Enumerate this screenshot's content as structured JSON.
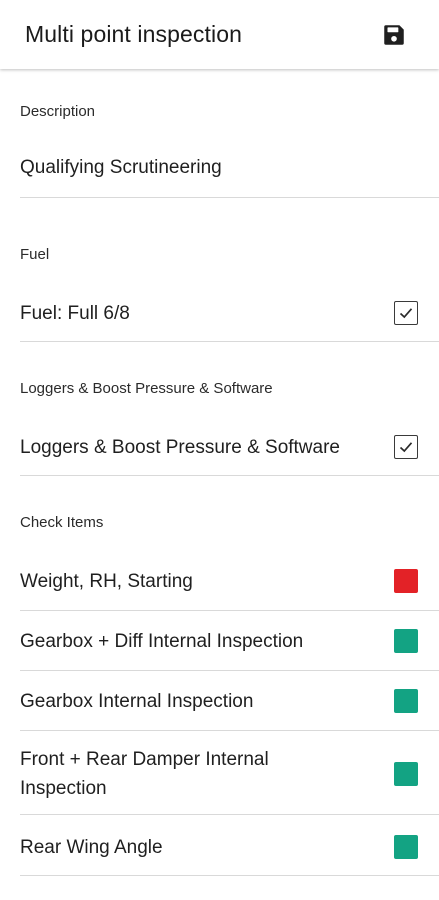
{
  "header": {
    "title": "Multi point inspection",
    "save_icon": "save-icon"
  },
  "description": {
    "label": "Description",
    "value": "Qualifying Scrutineering"
  },
  "fuel": {
    "section_label": "Fuel",
    "item_label": "Fuel: Full 6/8",
    "checked": true
  },
  "loggers": {
    "section_label": "Loggers & Boost Pressure & Software",
    "item_label": "Loggers & Boost Pressure & Software",
    "checked": true
  },
  "check_items": {
    "section_label": "Check Items",
    "items": [
      {
        "label": "Weight, RH, Starting",
        "status_color": "#e32227"
      },
      {
        "label": "Gearbox + Diff Internal Inspection",
        "status_color": "#13a383"
      },
      {
        "label": "Gearbox Internal Inspection",
        "status_color": "#13a383"
      },
      {
        "label": "Front + Rear Damper Internal Inspection",
        "status_color": "#13a383"
      },
      {
        "label": "Rear Wing Angle",
        "status_color": "#13a383"
      }
    ]
  }
}
